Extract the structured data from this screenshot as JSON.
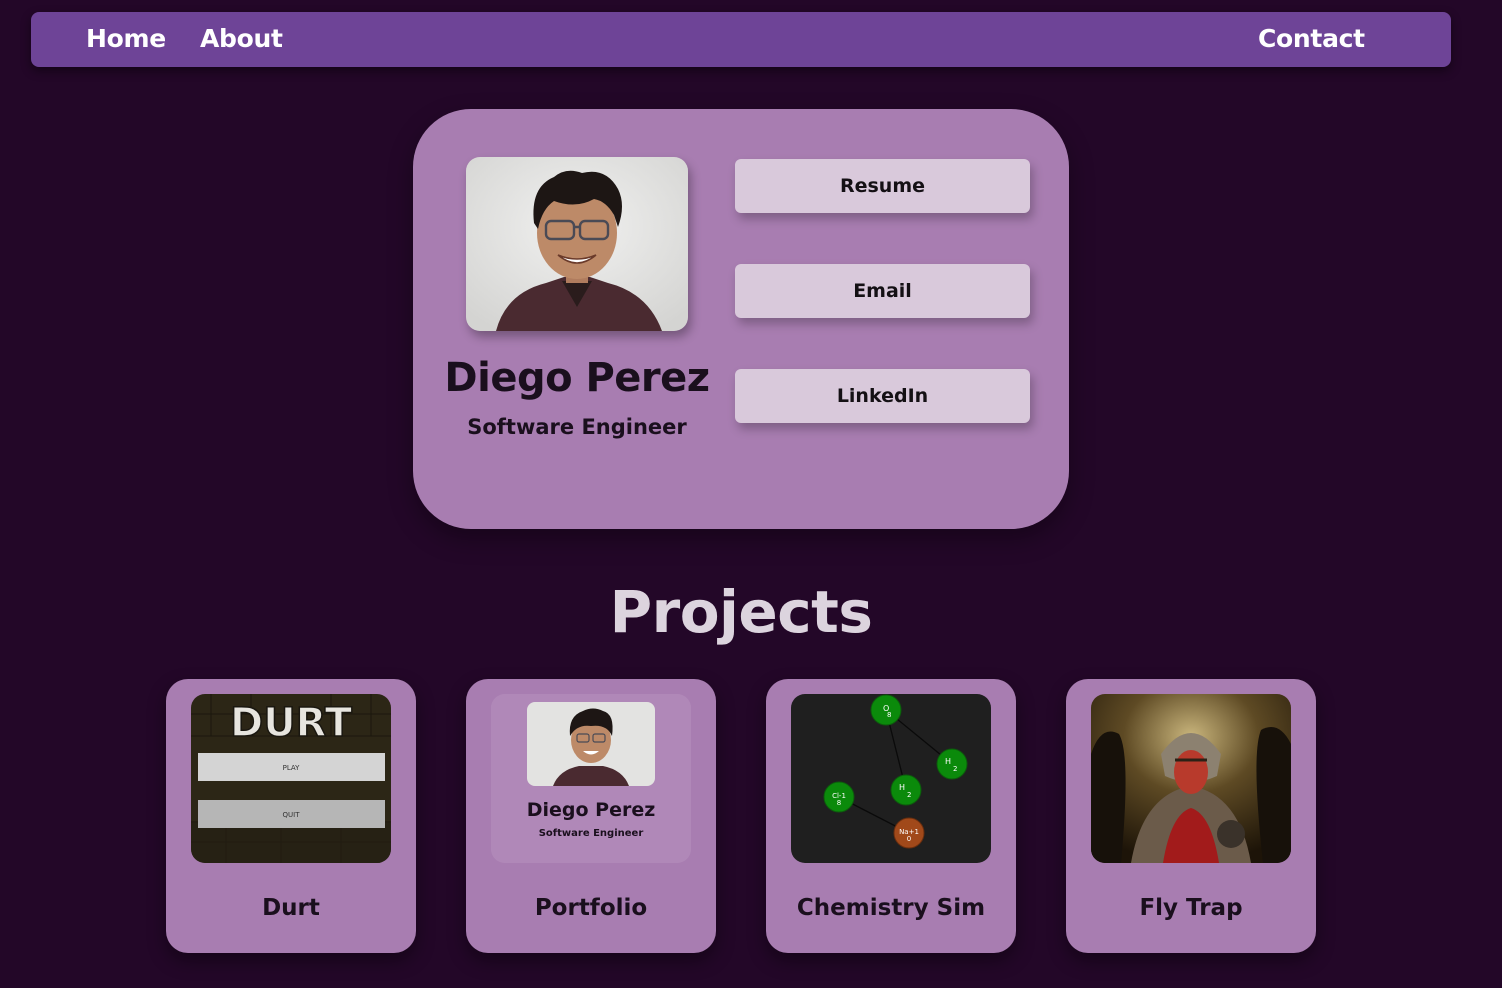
{
  "nav": {
    "home": "Home",
    "about": "About",
    "contact": "Contact"
  },
  "profile": {
    "name": "Diego Perez",
    "title": "Software Engineer",
    "buttons": [
      "Resume",
      "Email",
      "LinkedIn"
    ]
  },
  "projects": {
    "heading": "Projects",
    "items": [
      {
        "label": "Durt",
        "thumb": {
          "logo": "DURT",
          "play": "PLAY",
          "quit": "QUIT"
        }
      },
      {
        "label": "Portfolio",
        "thumb": {
          "name": "Diego Perez",
          "title": "Software Engineer"
        }
      },
      {
        "label": "Chemistry Sim",
        "thumb": {
          "atoms": [
            {
              "symbol": "O",
              "charge": "8"
            },
            {
              "symbol": "H",
              "charge": "2"
            },
            {
              "symbol": "H",
              "charge": "2"
            },
            {
              "symbol": "Cl-1",
              "charge": "8"
            },
            {
              "symbol": "Na+1",
              "charge": "0"
            }
          ]
        }
      },
      {
        "label": "Fly Trap"
      }
    ]
  },
  "colors": {
    "background": "#230728",
    "navbar": "#6e4497",
    "card": "#a87db1",
    "button": "#d9c9db",
    "heading": "#dcd4de"
  }
}
